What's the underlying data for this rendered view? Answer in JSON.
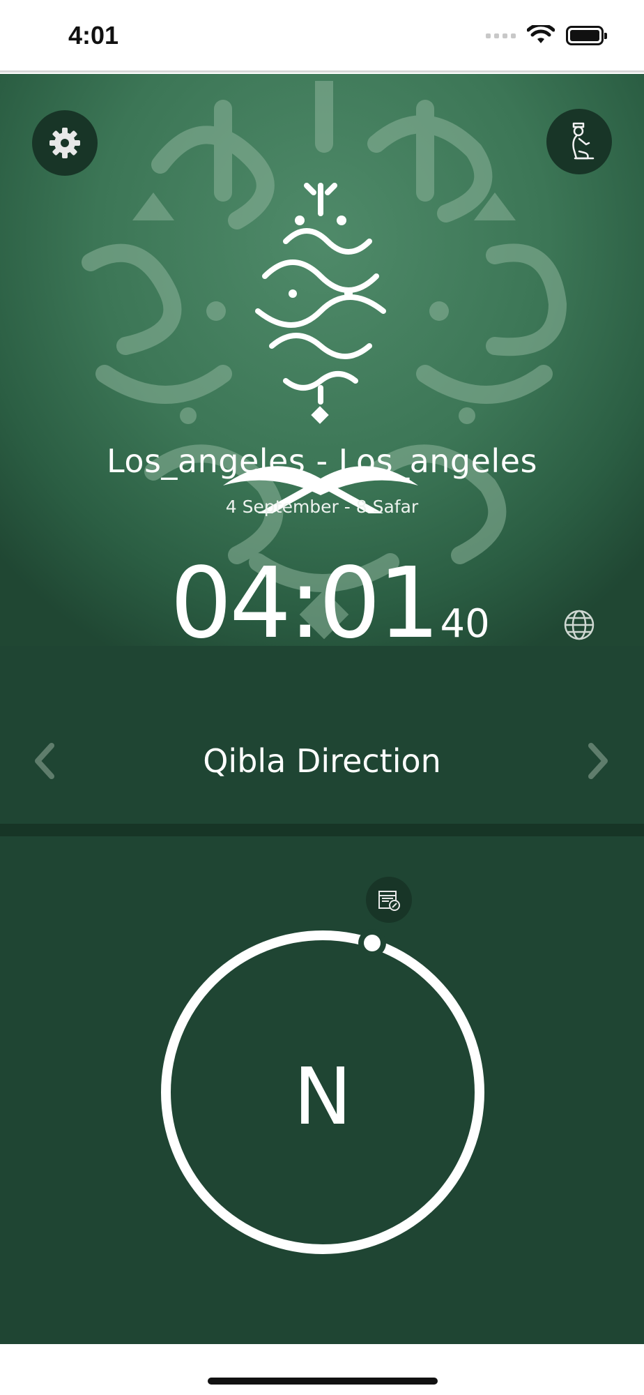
{
  "status_bar": {
    "time": "4:01"
  },
  "header": {
    "location": "Los_angeles - Los_angeles",
    "date": "4 September - 8 Safar",
    "clock": {
      "hours_minutes": "04:01",
      "seconds": "40"
    }
  },
  "navigation": {
    "section_title": "Qibla Direction"
  },
  "compass": {
    "direction_letter": "N"
  },
  "colors": {
    "header_green": "#3c7656",
    "panel_green": "#1f4533",
    "button_dark": "#183527",
    "text": "#ffffff"
  },
  "icons": {
    "settings": "gear-icon",
    "prayer": "praying-man-icon",
    "globe": "globe-icon",
    "previous": "chevron-left-icon",
    "next": "chevron-right-icon",
    "kaaba": "kaaba-icon"
  }
}
